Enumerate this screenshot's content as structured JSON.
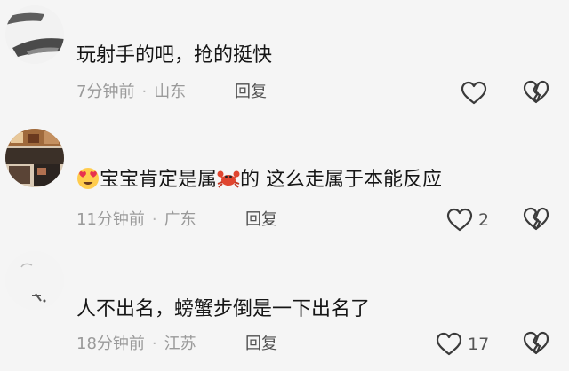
{
  "comments": [
    {
      "text": "玩射手的吧，抢的挺快",
      "time": "7分钟前",
      "location": "山东",
      "reply_label": "回复",
      "like_count": ""
    },
    {
      "text_emoji_1": "heart-eyes-emoji",
      "text_part1": "宝宝肯定是属",
      "text_emoji_2": "crab-emoji",
      "text_part2": "的 这么走属于本能反应",
      "time": "11分钟前",
      "location": "广东",
      "reply_label": "回复",
      "like_count": "2"
    },
    {
      "text": "人不出名，螃蟹步倒是一下出名了",
      "time": "18分钟前",
      "location": "江苏",
      "reply_label": "回复",
      "like_count": "17"
    }
  ],
  "colors": {
    "background": "#f5f5f5",
    "text": "#161616",
    "meta": "#9a9a9a",
    "icon": "#3a3a3a"
  }
}
